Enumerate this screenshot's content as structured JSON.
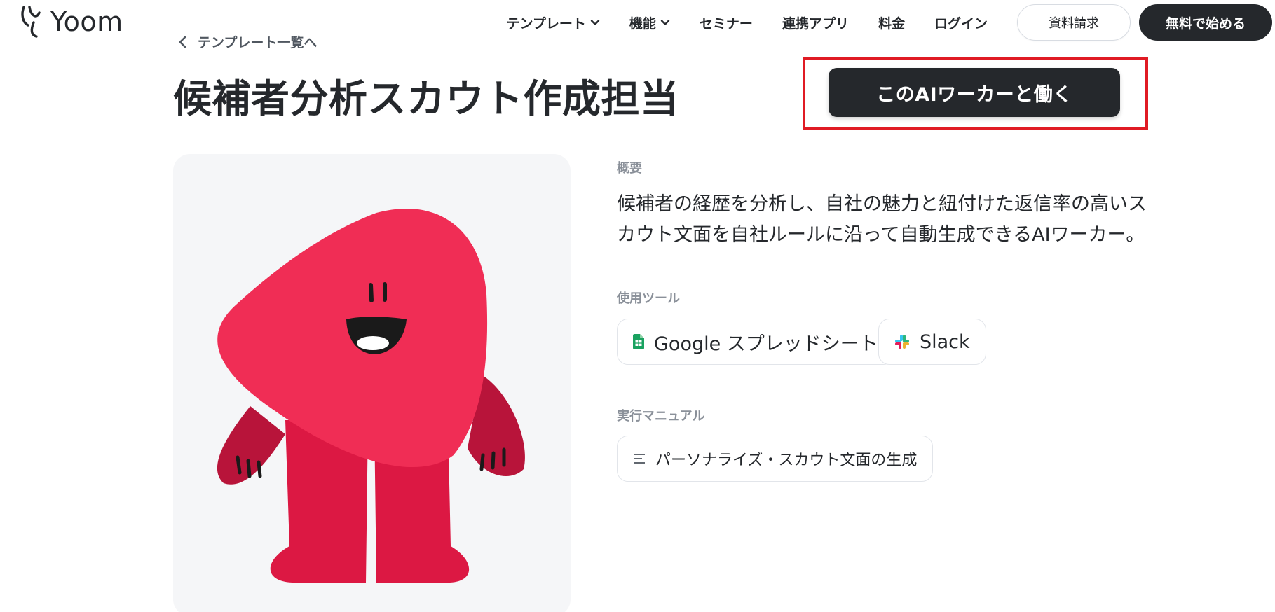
{
  "header": {
    "logo_text": "Yoom",
    "nav": [
      {
        "label": "テンプレート",
        "has_dropdown": true
      },
      {
        "label": "機能",
        "has_dropdown": true
      },
      {
        "label": "セミナー",
        "has_dropdown": false
      },
      {
        "label": "連携アプリ",
        "has_dropdown": false
      },
      {
        "label": "料金",
        "has_dropdown": false
      },
      {
        "label": "ログイン",
        "has_dropdown": false
      }
    ],
    "request_docs_label": "資料請求",
    "start_free_label": "無料で始める"
  },
  "back_link": "テンプレート一覧へ",
  "title": "候補者分析スカウト作成担当",
  "cta_label": "このAIワーカーと働く",
  "overview": {
    "label": "概要",
    "text": "候補者の経歴を分析し、自社の魅力と紐付けた返信率の高いスカウト文面を自社ルールに沿って自動生成できるAIワーカー。"
  },
  "tools": {
    "label": "使用ツール",
    "items": [
      {
        "label": "Google スプレッドシート",
        "icon": "google-sheets-icon"
      },
      {
        "label": "Slack",
        "icon": "slack-icon"
      }
    ]
  },
  "manual": {
    "label": "実行マニュアル",
    "items": [
      {
        "label": "パーソナライズ・スカウト文面の生成",
        "icon": "list-icon"
      }
    ]
  },
  "colors": {
    "dark": "#25282c",
    "highlight_border": "#e01b24",
    "character_body": "#f02d55",
    "character_limbs": "#dc1843",
    "sheets_green": "#1aa260"
  }
}
